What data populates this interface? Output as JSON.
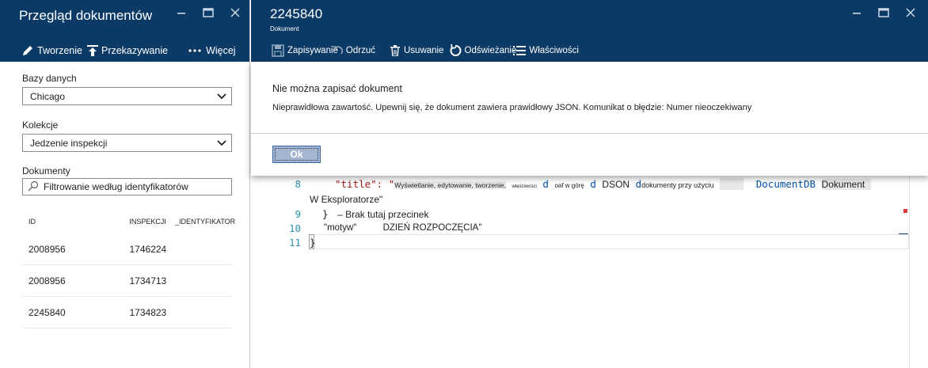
{
  "left_blade": {
    "title": "Przegląd dokumentów",
    "toolbar": {
      "create": "Tworzenie",
      "upload": "Przekazywanie",
      "more": "Więcej"
    },
    "databases_label": "Bazy danych",
    "database_value": "Chicago",
    "collections_label": "Kolekcje",
    "collection_value": "Jedzenie inspekcji",
    "documents_label": "Dokumenty",
    "filter_placeholder": "Filtrowanie według identyfikatorów",
    "table": {
      "columns": [
        "ID",
        "INSPEKCJI",
        "_IDENTYFIKATOR"
      ],
      "rows": [
        [
          "2008956",
          "1746224",
          ""
        ],
        [
          "2008956",
          "1734713",
          ""
        ],
        [
          "2245840",
          "1734823",
          ""
        ]
      ]
    }
  },
  "right_blade": {
    "title": "2245840",
    "subtitle": "Dokument",
    "toolbar": {
      "save": "Zapisywanie",
      "discard": "Odrzuć",
      "delete": "Usuwanie",
      "refresh": "Odświeżanie",
      "properties": "Właściwości"
    },
    "editor": {
      "line_numbers": [
        "8",
        "9",
        "10",
        "11"
      ],
      "line8_key": "\"title\": \"",
      "line8_a": "Wyświetlanie, edytowanie, tworzenie,",
      "line8_b": "właściwości",
      "line8_c": "d",
      "line8_d": "oaf w górę",
      "line8_e": "d",
      "line8_f": "DSON",
      "line8_g": "d",
      "line8_h": "dokumenty przy użyciu",
      "line8_i": "DocumentDB",
      "line8_j": "Dokument",
      "line8_wrap": "W Eksploratorze\"",
      "line9_brace": "}",
      "line9_comment": "– Brak tutaj przecinek",
      "line10_key": "\"motyw\"",
      "line10_value": "DZIEŃ ROZPOCZĘCIA\"",
      "line11": "}"
    }
  },
  "dialog": {
    "title": "Nie można zapisać dokument",
    "message": "Nieprawidłowa zawartość. Upewnij się, że dokument zawiera prawidłowy JSON. Komunikat o błędzie: Numer nieoczekiwany",
    "ok_label": "Ok"
  },
  "colors": {
    "header_bg": "#0c3a66",
    "dialog_button": "#a4b6cf",
    "line_number": "#2b91af",
    "string": "#a31515"
  }
}
